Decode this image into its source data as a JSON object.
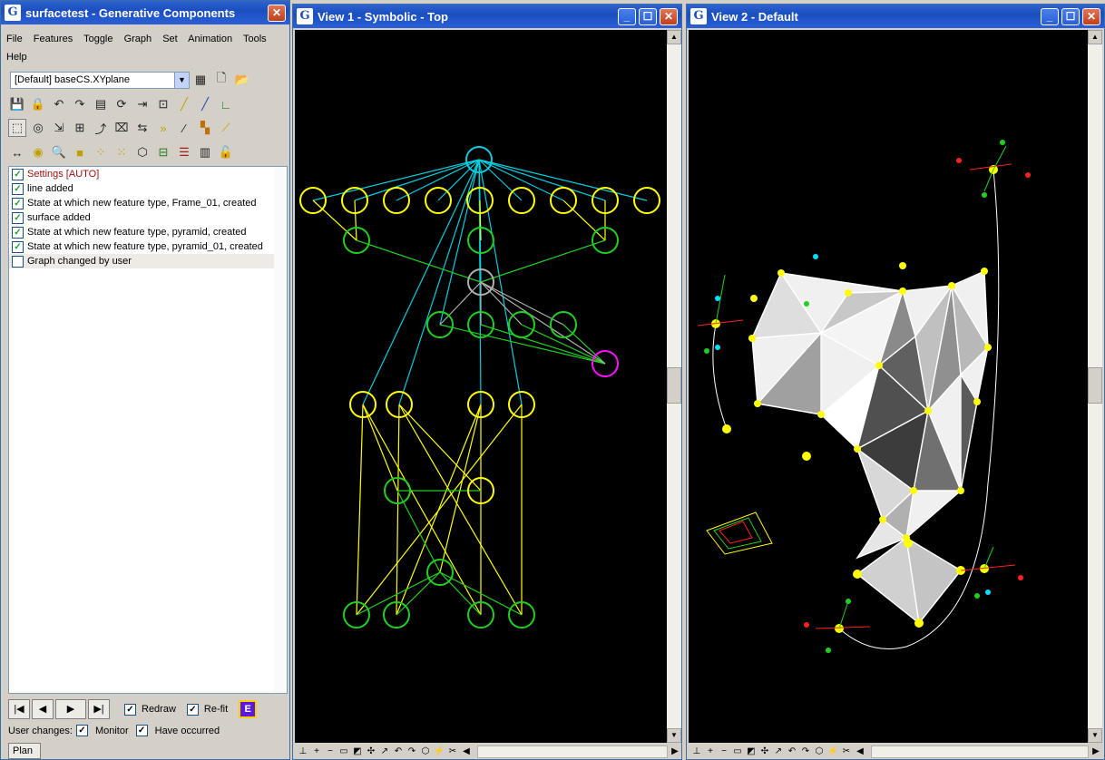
{
  "main_window": {
    "title": "surfacetest - Generative Components",
    "menu": [
      "File",
      "Features",
      "Toggle",
      "Graph",
      "Set",
      "Animation",
      "Tools",
      "Help"
    ],
    "plane_select": "[Default] baseCS.XYplane",
    "history": [
      {
        "label": "Settings [AUTO]",
        "checked": true,
        "highlight": true
      },
      {
        "label": "line added",
        "checked": true
      },
      {
        "label": "State at which new feature type, Frame_01, created",
        "checked": true
      },
      {
        "label": "surface added",
        "checked": true
      },
      {
        "label": "State at which new feature type, pyramid, created",
        "checked": true
      },
      {
        "label": "State at which new feature type, pyramid_01, created",
        "checked": true
      },
      {
        "label": "Graph changed by user",
        "checked": false
      }
    ],
    "nav": {
      "first": "|◀",
      "prev": "◀",
      "next": "▶",
      "last": "▶|",
      "redraw": "Redraw",
      "refit": "Re-fit",
      "e_button": "E"
    },
    "status": {
      "label": "User changes:",
      "monitor": "Monitor",
      "occurred": "Have occurred"
    },
    "plan_tab": "Plan"
  },
  "view1": {
    "title": "View 1 - Symbolic - Top"
  },
  "view2": {
    "title": "View 2 - Default"
  },
  "icons": {
    "app": "gc-app-icon",
    "minimize": "minimize-icon",
    "maximize": "maximize-icon",
    "close": "close-icon"
  }
}
